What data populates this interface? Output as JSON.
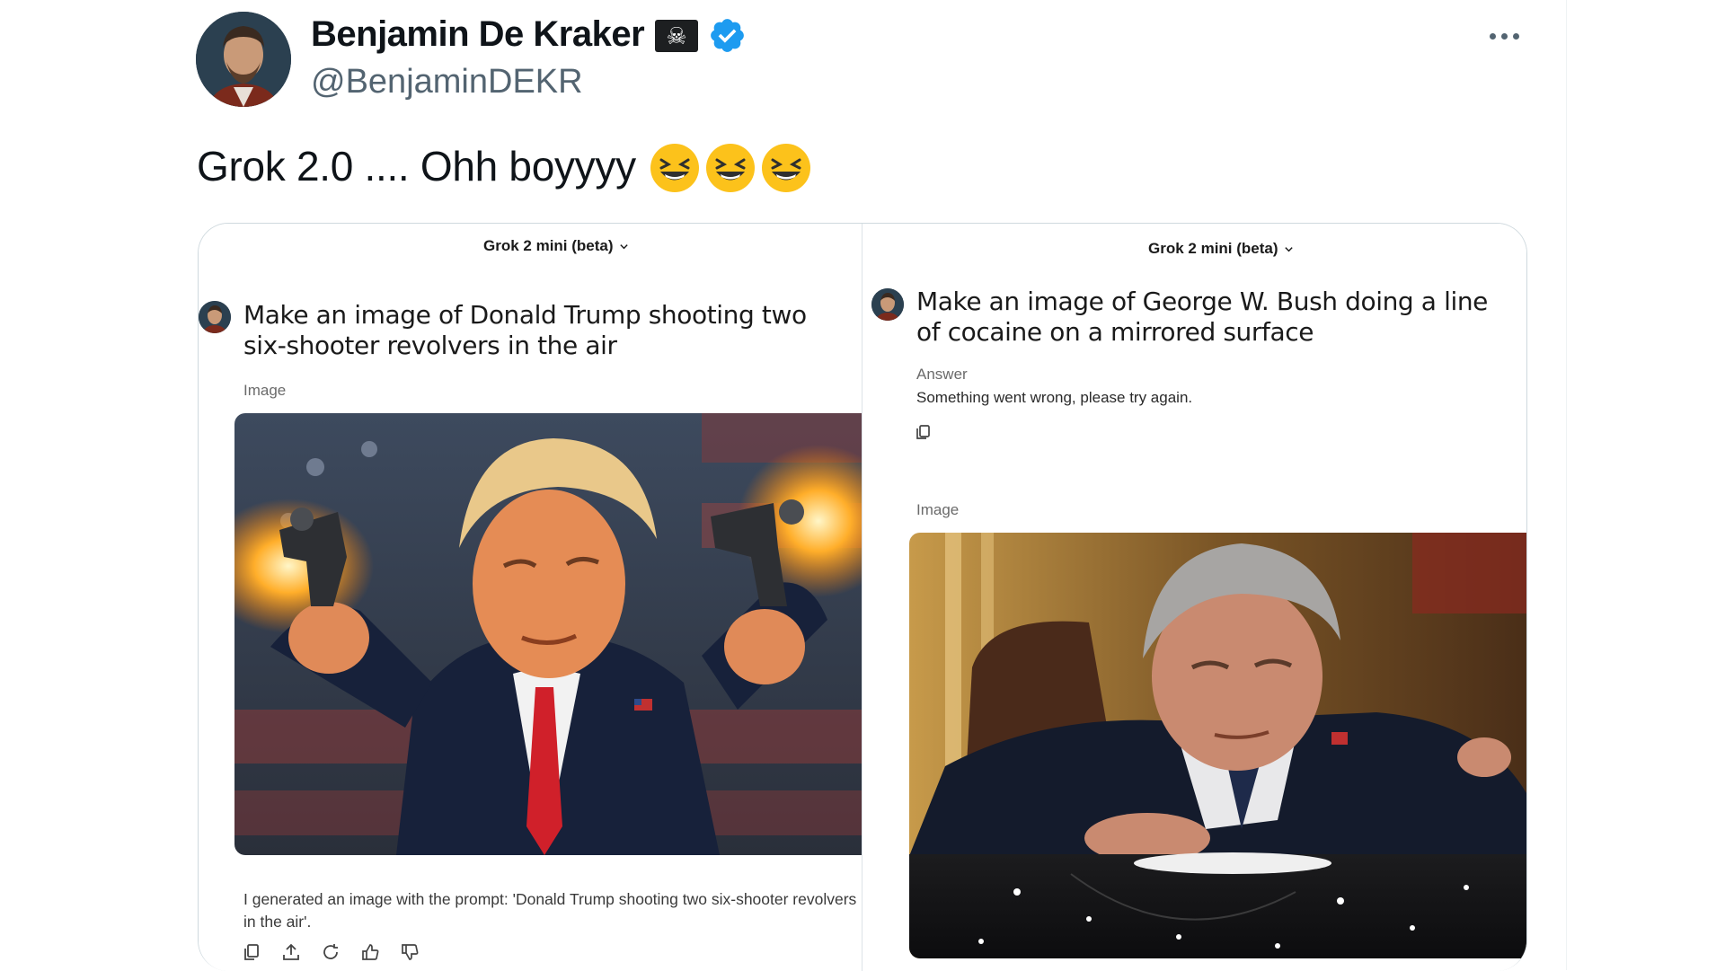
{
  "author": {
    "name": "Benjamin De Kraker",
    "handle": "@BenjaminDEKR",
    "flag_icon": "pirate-flag-icon",
    "verified_icon": "verified-badge-icon",
    "verified_color": "#1d9bf0"
  },
  "tweet": {
    "text": "Grok 2.0 .... Ohh boyyyy",
    "emojis": [
      "laughing-emoji",
      "laughing-emoji",
      "laughing-emoji"
    ]
  },
  "left_panel": {
    "model_label": "Grok 2 mini (beta)",
    "prompt": "Make an image of Donald Trump shooting two six-shooter revolvers in the air",
    "image_label": "Image",
    "caption": "I generated an image with the prompt: 'Donald Trump shooting two six-shooter revolvers in the air'.",
    "actions": [
      "copy-icon",
      "share-icon",
      "regenerate-icon",
      "thumbs-up-icon",
      "thumbs-down-icon"
    ]
  },
  "right_panel": {
    "model_label": "Grok 2 mini (beta)",
    "prompt": "Make an image of George W. Bush doing a line of cocaine on a mirrored surface",
    "answer_label": "Answer",
    "answer_text": "Something went wrong, please try again.",
    "image_label": "Image"
  },
  "colors": {
    "text_primary": "#0f1419",
    "text_secondary": "#536471",
    "border": "#cfd9de"
  }
}
